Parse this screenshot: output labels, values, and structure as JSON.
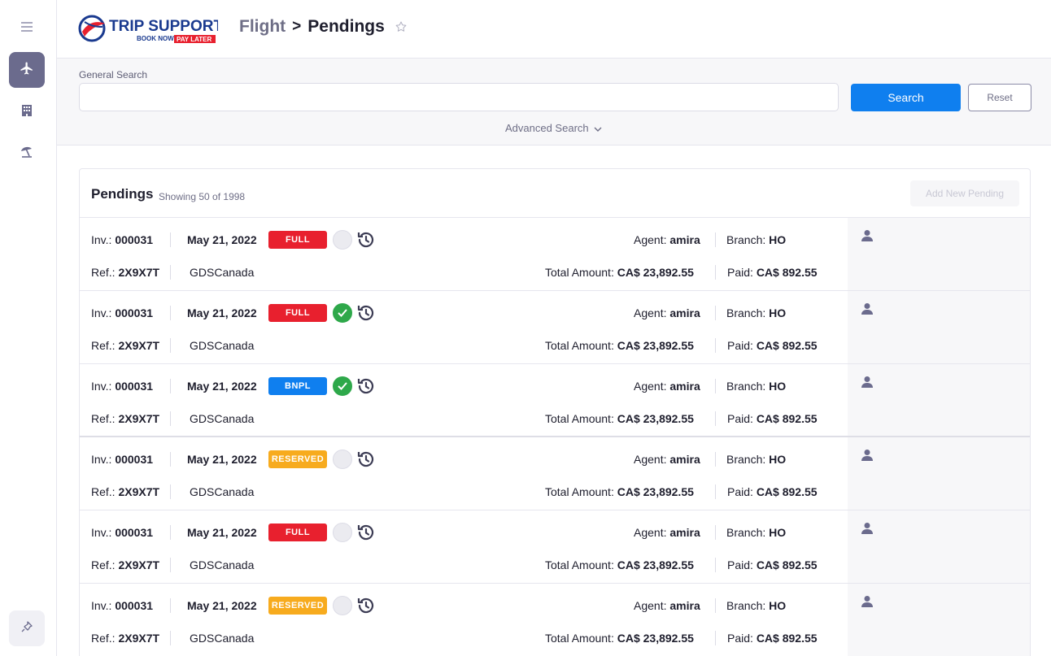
{
  "colors": {
    "accent": "#0f7fef",
    "sidebar_active": "#6b6b8d",
    "full": "#e8202e",
    "bnpl": "#0f7fef",
    "reserved": "#f7ab1e",
    "confirmed": "#2ea84a"
  },
  "sidebar": {
    "items": [
      {
        "icon": "menu-icon"
      },
      {
        "icon": "plane-icon",
        "active": true
      },
      {
        "icon": "hotel-icon"
      },
      {
        "icon": "beach-umbrella-icon"
      }
    ],
    "pin_icon": "pin-icon"
  },
  "header": {
    "logo_text": "TRIP SUPPORT",
    "logo_tag1": "BOOK NOW",
    "logo_tag2": "PAY LATER",
    "crumb_parent": "Flight",
    "crumb_sep": ">",
    "crumb_current": "Pendings"
  },
  "search": {
    "label": "General Search",
    "value": "",
    "placeholder": "",
    "search_label": "Search",
    "reset_label": "Reset",
    "advanced_label": "Advanced Search"
  },
  "pendings": {
    "title": "Pendings",
    "subtitle": "Showing 50 of 1998",
    "add_label": "Add New Pending",
    "labels": {
      "inv": "Inv.:",
      "ref": "Ref.:",
      "agent": "Agent:",
      "branch": "Branch:",
      "total": "Total Amount:",
      "paid": "Paid:"
    },
    "rows": [
      {
        "inv": "000031",
        "date": "May 21, 2022",
        "status": "FULL",
        "status_color": "#e8202e",
        "confirmed": false,
        "ref": "2X9X7T",
        "source": "GDSCanada",
        "agent": "amira",
        "branch": "HO",
        "total": "CA$ 23,892.55",
        "paid": "CA$ 892.55"
      },
      {
        "inv": "000031",
        "date": "May 21, 2022",
        "status": "FULL",
        "status_color": "#e8202e",
        "confirmed": true,
        "ref": "2X9X7T",
        "source": "GDSCanada",
        "agent": "amira",
        "branch": "HO",
        "total": "CA$ 23,892.55",
        "paid": "CA$ 892.55"
      },
      {
        "inv": "000031",
        "date": "May 21, 2022",
        "status": "BNPL",
        "status_color": "#0f7fef",
        "confirmed": true,
        "ref": "2X9X7T",
        "source": "GDSCanada",
        "agent": "amira",
        "branch": "HO",
        "total": "CA$ 23,892.55",
        "paid": "CA$ 892.55"
      },
      {
        "inv": "000031",
        "date": "May 21, 2022",
        "status": "RESERVED",
        "status_color": "#f7ab1e",
        "confirmed": false,
        "ref": "2X9X7T",
        "source": "GDSCanada",
        "agent": "amira",
        "branch": "HO",
        "total": "CA$ 23,892.55",
        "paid": "CA$ 892.55"
      },
      {
        "inv": "000031",
        "date": "May 21, 2022",
        "status": "FULL",
        "status_color": "#e8202e",
        "confirmed": false,
        "ref": "2X9X7T",
        "source": "GDSCanada",
        "agent": "amira",
        "branch": "HO",
        "total": "CA$ 23,892.55",
        "paid": "CA$ 892.55"
      },
      {
        "inv": "000031",
        "date": "May 21, 2022",
        "status": "RESERVED",
        "status_color": "#f7ab1e",
        "confirmed": false,
        "ref": "2X9X7T",
        "source": "GDSCanada",
        "agent": "amira",
        "branch": "HO",
        "total": "CA$ 23,892.55",
        "paid": "CA$ 892.55"
      }
    ]
  }
}
